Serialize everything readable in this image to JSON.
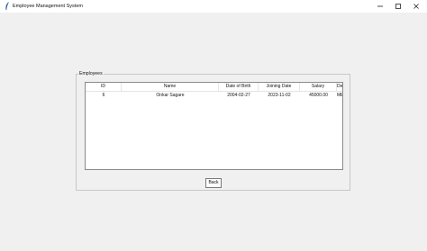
{
  "window": {
    "title": "Employee Management System"
  },
  "employees_group": {
    "label": "Employees",
    "columns": [
      "ID",
      "Name",
      "Date of Birth",
      "Joining Date",
      "Salary",
      "Department"
    ],
    "rows": [
      [
        "6",
        "Onkar Sagare",
        "2004-02-27",
        "2023-11-02",
        "45000.00",
        "MECH"
      ]
    ]
  },
  "back_button": {
    "label": "Back"
  }
}
